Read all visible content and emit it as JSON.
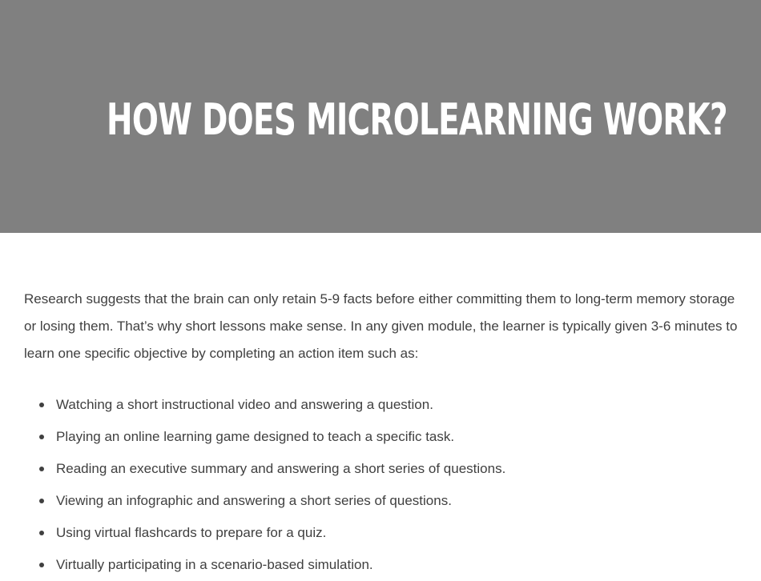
{
  "hero": {
    "title": "How Does Microlearning Work?",
    "background_color": "#808080",
    "title_color": "#ffffff"
  },
  "content": {
    "intro": "Research suggests that the brain can only retain 5-9 facts before either committing them to long-term memory storage or losing them. That’s why short lessons make sense. In any given module, the learner is typically given 3-6 minutes to learn one specific objective by completing an action item such as:",
    "items": [
      "Watching a short instructional video and answering a question.",
      "Playing an online learning game designed to teach a specific task.",
      "Reading an executive summary and answering a short series of questions.",
      "Viewing an infographic and answering a short series of questions.",
      "Using virtual flashcards to prepare for a quiz.",
      "Virtually participating in a scenario-based simulation."
    ],
    "text_color": "#404040"
  }
}
